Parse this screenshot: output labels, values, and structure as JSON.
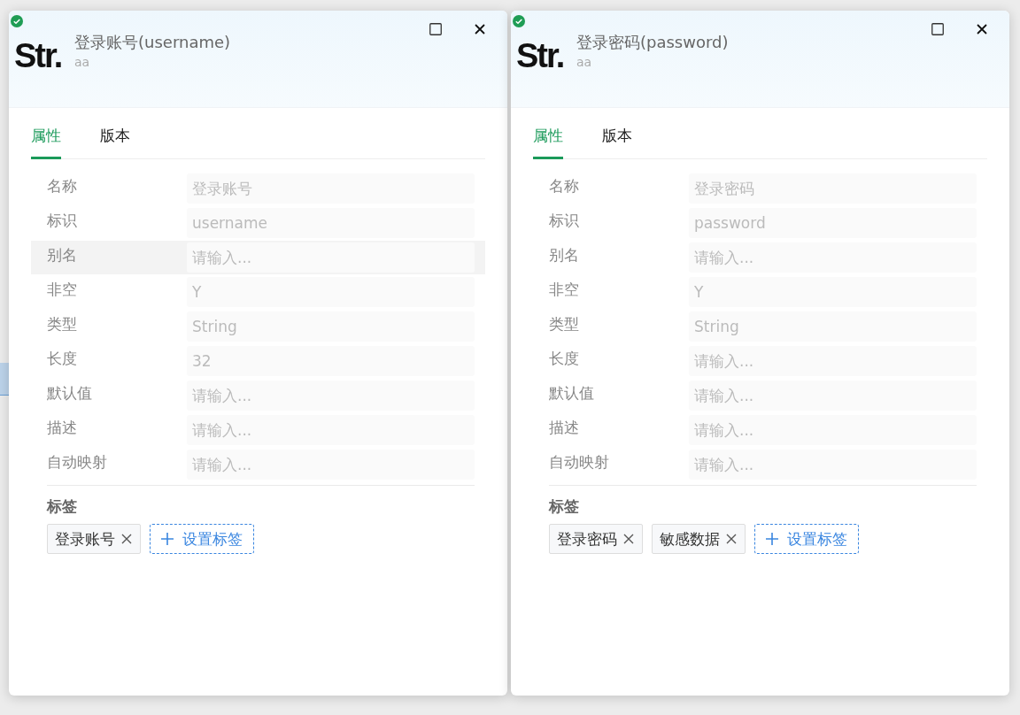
{
  "panels": [
    {
      "logo": "Str.",
      "title": "登录账号(username)",
      "subtitle": "aa",
      "tabs": [
        {
          "label": "属性",
          "selected": true
        },
        {
          "label": "版本",
          "selected": false
        }
      ],
      "fields": [
        {
          "label": "名称",
          "value": "登录账号",
          "highlighted": false
        },
        {
          "label": "标识",
          "value": "username",
          "highlighted": false
        },
        {
          "label": "别名",
          "placeholder": "请输入...",
          "highlighted": true
        },
        {
          "label": "非空",
          "value": "Y",
          "highlighted": false
        },
        {
          "label": "类型",
          "value": "String",
          "highlighted": false
        },
        {
          "label": "长度",
          "value": "32",
          "highlighted": false
        },
        {
          "label": "默认值",
          "placeholder": "请输入...",
          "highlighted": false
        },
        {
          "label": "描述",
          "placeholder": "请输入...",
          "highlighted": false
        },
        {
          "label": "自动映射",
          "placeholder": "请输入...",
          "highlighted": false
        }
      ],
      "tags_heading": "标签",
      "tags": [
        "登录账号"
      ],
      "add_tag_button": "设置标签"
    },
    {
      "logo": "Str.",
      "title": "登录密码(password)",
      "subtitle": "aa",
      "tabs": [
        {
          "label": "属性",
          "selected": true
        },
        {
          "label": "版本",
          "selected": false
        }
      ],
      "fields": [
        {
          "label": "名称",
          "value": "登录密码",
          "highlighted": false
        },
        {
          "label": "标识",
          "value": "password",
          "highlighted": false
        },
        {
          "label": "别名",
          "placeholder": "请输入...",
          "highlighted": false
        },
        {
          "label": "非空",
          "value": "Y",
          "highlighted": false
        },
        {
          "label": "类型",
          "value": "String",
          "highlighted": false
        },
        {
          "label": "长度",
          "placeholder": "请输入...",
          "highlighted": false
        },
        {
          "label": "默认值",
          "placeholder": "请输入...",
          "highlighted": false
        },
        {
          "label": "描述",
          "placeholder": "请输入...",
          "highlighted": false
        },
        {
          "label": "自动映射",
          "placeholder": "请输入...",
          "highlighted": false
        }
      ],
      "tags_heading": "标签",
      "tags": [
        "登录密码",
        "敏感数据"
      ],
      "add_tag_button": "设置标签"
    }
  ]
}
